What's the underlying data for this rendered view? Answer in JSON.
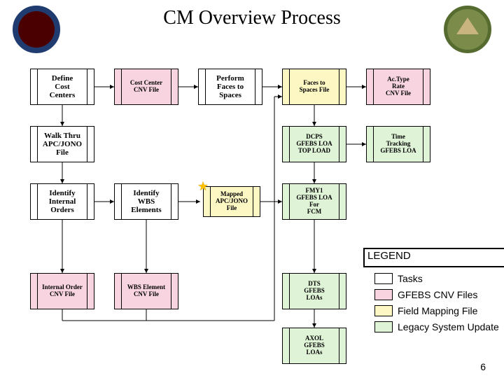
{
  "title": "CM Overview Process",
  "page_number": "6",
  "colors": {
    "task": "#fff",
    "cnv": "#f7d4e0",
    "mapping": "#fdf7c4",
    "legacy": "#dff3d6"
  },
  "boxes": {
    "defineCostCenters": "Define\nCost\nCenters",
    "costCenterCnv": "Cost Center\nCNV File",
    "performFaces": "Perform\nFaces to\nSpaces",
    "facesSpacesFile": "Faces to\nSpaces File",
    "acTypeRate": "Ac.Type\nRate\nCNV File",
    "walkThru": "Walk Thru\nAPC/JONO\nFile",
    "dcpsLoa": "DCPS\nGFEBS LOA\nTOP LOAD",
    "timeTracking": "Time\nTracking\nGFEBS LOA",
    "identifyIO": "Identify\nInternal\nOrders",
    "identifyWbs": "Identify\nWBS\nElements",
    "mappedApc": "Mapped\nAPC/JONO\nFile",
    "fmy1": "FMY1\nGFEBS LOA\nFor\nFCM",
    "ioCnv": "Internal Order\nCNV File",
    "wbsCnv": "WBS Element\nCNV File",
    "dtsLoa": "DTS\nGFEBS\nLOAs",
    "axolLoa": "AXOL\nGFEBS\nLOAs"
  },
  "legend": {
    "title": "LEGEND",
    "items": [
      {
        "swatch": "task",
        "label": "Tasks"
      },
      {
        "swatch": "cnv",
        "label": "GFEBS CNV Files"
      },
      {
        "swatch": "mapping",
        "label": "Field Mapping File"
      },
      {
        "swatch": "legacy",
        "label": "Legacy System Update"
      }
    ]
  }
}
